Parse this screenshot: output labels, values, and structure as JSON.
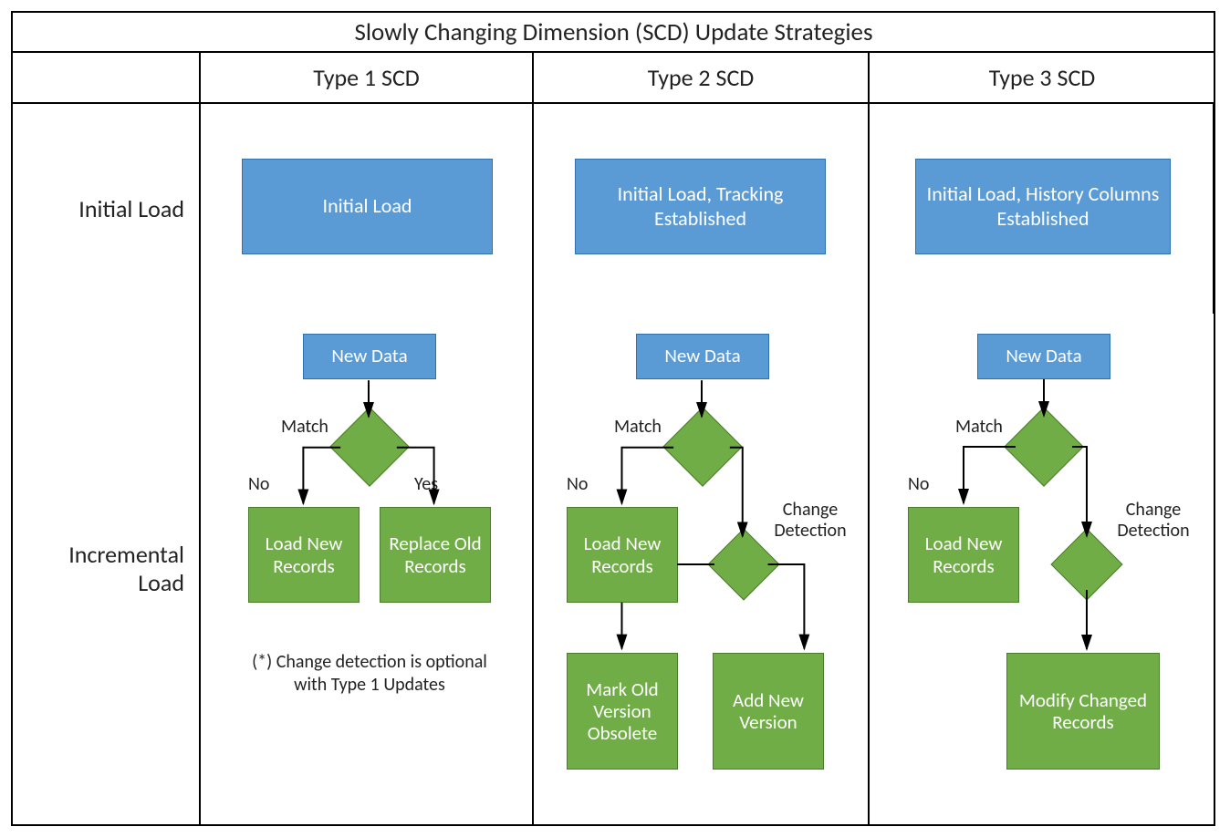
{
  "title": "Slowly Changing Dimension (SCD) Update Strategies",
  "columns": {
    "blank": "",
    "c1": "Type 1 SCD",
    "c2": "Type 2 SCD",
    "c3": "Type 3 SCD"
  },
  "rows": {
    "r1": "Initial Load",
    "r2": "Incremental Load"
  },
  "initial": {
    "c1": "Initial Load",
    "c2": "Initial Load, Tracking Established",
    "c3": "Initial Load, History Columns Established"
  },
  "incremental": {
    "newdata": "New Data",
    "match": "Match",
    "no": "No",
    "yes": "Yes",
    "change_detection": "Change Detection",
    "load_new": "Load New Records",
    "replace_old": "Replace Old Records",
    "mark_obsolete": "Mark Old Version Obsolete",
    "add_version": "Add New Version",
    "modify_changed": "Modify Changed Records",
    "footnote": "(*) Change detection is optional with Type 1 Updates"
  },
  "colors": {
    "blue": "#5b9bd5",
    "green": "#70ad47"
  }
}
